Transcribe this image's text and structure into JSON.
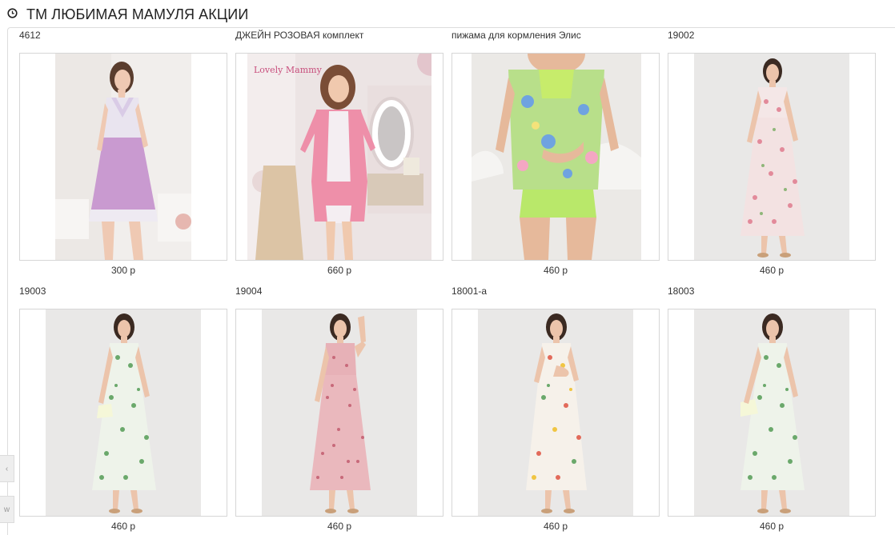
{
  "header": {
    "title": "ТМ ЛЮБИМАЯ МАМУЛЯ АКЦИИ",
    "icon": "clock-icon"
  },
  "side_tabs": [
    {
      "icon": "arrow-icon",
      "label": "‹"
    },
    {
      "icon": "letter-w-icon",
      "label": "w"
    }
  ],
  "products": [
    {
      "name": "4612",
      "price": "300 р",
      "photo": "lilac-nightgown"
    },
    {
      "name": "ДЖЕЙН РОЗОВАЯ комплект",
      "price": "660 р",
      "photo": "pink-robe-set"
    },
    {
      "name": "пижама для кормления Элис",
      "price": "460 р",
      "photo": "green-floral-pajama"
    },
    {
      "name": "19002",
      "price": "460 р",
      "photo": "pink-floral-sundress"
    },
    {
      "name": "19003",
      "price": "460 р",
      "photo": "green-floral-sundress"
    },
    {
      "name": "19004",
      "price": "460 р",
      "photo": "pink-print-sundress"
    },
    {
      "name": "18001-а",
      "price": "460 р",
      "photo": "multicolor-floral-sundress"
    },
    {
      "name": "18003",
      "price": "460 р",
      "photo": "green-floral-sundress"
    }
  ],
  "colors": {
    "border": "#d6d6d6",
    "photo_bg": "#eeeeee",
    "text": "#333333"
  }
}
